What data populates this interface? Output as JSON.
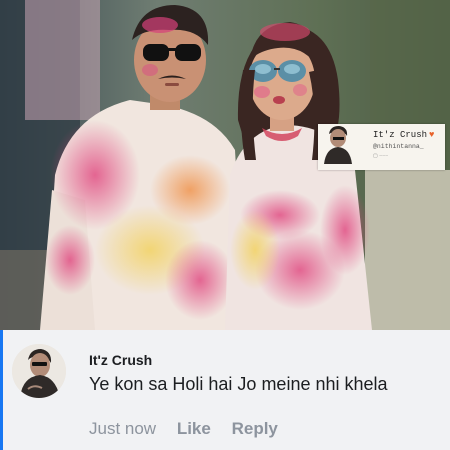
{
  "photo": {
    "alt_icon": "holi-couple-photo",
    "watermark": {
      "name": "It'z Crush",
      "emoji_icon": "fire-icon",
      "handle": "@nithintanna_"
    }
  },
  "comment": {
    "author": "It'z Crush",
    "text": "Ye kon sa Holi hai Jo meine nhi khela",
    "timestamp": "Just now",
    "like_label": "Like",
    "reply_label": "Reply",
    "accent_color": "#1877f2"
  }
}
